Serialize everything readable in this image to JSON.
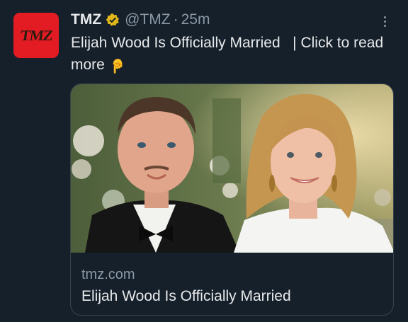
{
  "account": {
    "avatar_text": "TMZ",
    "display_name": "TMZ",
    "handle": "@TMZ",
    "separator": "·",
    "time": "25m"
  },
  "tweet": {
    "text": "Elijah Wood Is Officially Married   | Click to read more",
    "emoji": "👆"
  },
  "card": {
    "domain": "tmz.com",
    "title": "Elijah Wood Is Officially Married"
  },
  "colors": {
    "background": "#15202b",
    "text": "#e7e9ea",
    "muted": "#8b98a5",
    "verified_gold": "#e2b719",
    "brand_red": "#e31b23"
  },
  "icons": {
    "verified": "verified-badge-icon",
    "more": "more-options-icon",
    "emoji": "backhand-index-pointing-down"
  }
}
